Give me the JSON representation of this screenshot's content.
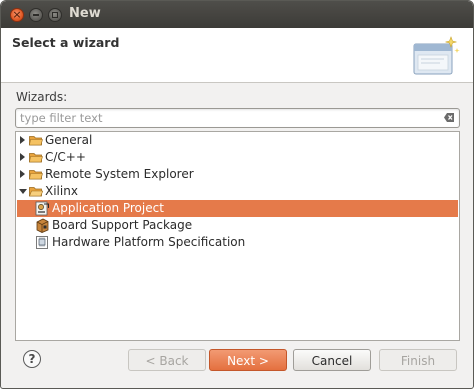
{
  "window": {
    "title": "New"
  },
  "header": {
    "title": "Select a wizard"
  },
  "wizards_label": "Wizards:",
  "filter": {
    "placeholder": "type filter text",
    "value": ""
  },
  "tree": {
    "items": [
      {
        "label": "General",
        "expanded": false,
        "level": 0,
        "icon": "folder-icon"
      },
      {
        "label": "C/C++",
        "expanded": false,
        "level": 0,
        "icon": "folder-icon"
      },
      {
        "label": "Remote System Explorer",
        "expanded": false,
        "level": 0,
        "icon": "folder-icon"
      },
      {
        "label": "Xilinx",
        "expanded": true,
        "level": 0,
        "icon": "folder-icon"
      },
      {
        "label": "Application Project",
        "level": 1,
        "selected": true,
        "icon": "application-project-icon"
      },
      {
        "label": "Board Support Package",
        "level": 1,
        "icon": "board-support-package-icon"
      },
      {
        "label": "Hardware Platform Specification",
        "level": 1,
        "icon": "hardware-platform-icon"
      }
    ]
  },
  "buttons": {
    "help": "?",
    "back": "< Back",
    "next": "Next >",
    "cancel": "Cancel",
    "finish": "Finish"
  },
  "colors": {
    "selection": "#e57a4a",
    "next_button": "#e4703f",
    "titlebar": "#3c3b37"
  }
}
